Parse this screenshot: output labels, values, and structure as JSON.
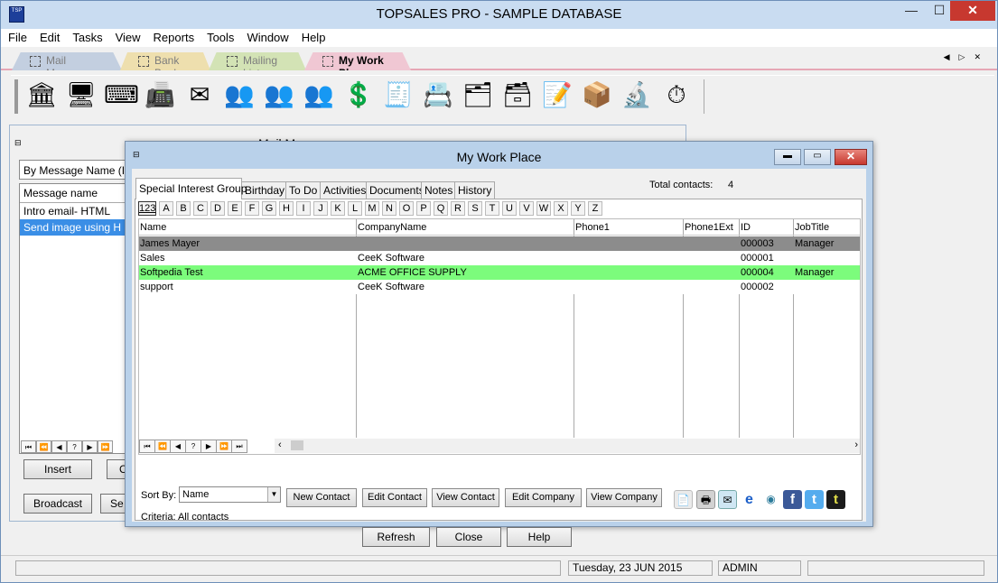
{
  "window": {
    "title": "TOPSALES PRO - SAMPLE DATABASE",
    "min": "—",
    "max": "☐",
    "close": "✕"
  },
  "menu": [
    "File",
    "Edit",
    "Tasks",
    "View",
    "Reports",
    "Tools",
    "Window",
    "Help"
  ],
  "doc_tabs": [
    "Mail Messages",
    "Bank Book",
    "Mailing Lists",
    "My Work Place"
  ],
  "toolbar_icons": [
    "🏛",
    "🖥",
    "⌨",
    "📠",
    "✉",
    "👥",
    "👥",
    "👥",
    "💲",
    "🧾",
    "📇",
    "🗂",
    "🗃",
    "📝",
    "📦",
    "🔬",
    "⏱"
  ],
  "mail": {
    "title": "Mail Messages",
    "sort_label": "By Message Name (I",
    "list_header": "Message name",
    "rows": [
      "Intro email- HTML",
      "Send image using H"
    ],
    "insert": "Insert",
    "ch": "Ch",
    "broadcast": "Broadcast",
    "se": "Se"
  },
  "mwp": {
    "title": "My Work Place",
    "tabs": [
      "Special Interest Group",
      "Birthday",
      "To Do",
      "Activities",
      "Documents",
      "Notes",
      "History"
    ],
    "total_label": "Total contacts:",
    "total_count": "4",
    "letters": [
      "123",
      "A",
      "B",
      "C",
      "D",
      "E",
      "F",
      "G",
      "H",
      "I",
      "J",
      "K",
      "L",
      "M",
      "N",
      "O",
      "P",
      "Q",
      "R",
      "S",
      "T",
      "U",
      "V",
      "W",
      "X",
      "Y",
      "Z"
    ],
    "columns": [
      "Name",
      "CompanyName",
      "Phone1",
      "Phone1Ext",
      "ID",
      "JobTitle"
    ],
    "rows": [
      {
        "name": "James Mayer",
        "company": "",
        "phone": "",
        "ext": "",
        "id": "000003",
        "job": "Manager",
        "color": "#8c8c8c"
      },
      {
        "name": "Sales",
        "company": "CeeK Software",
        "phone": "",
        "ext": "",
        "id": "000001",
        "job": "",
        "color": "#ffffff"
      },
      {
        "name": "Softpedia Test",
        "company": "ACME OFFICE SUPPLY",
        "phone": "",
        "ext": "",
        "id": "000004",
        "job": "Manager",
        "color": "#7cfc7c"
      },
      {
        "name": "support",
        "company": "CeeK Software",
        "phone": "",
        "ext": "",
        "id": "000002",
        "job": "",
        "color": "#ffffff"
      }
    ],
    "sort_by_label": "Sort By:",
    "sort_by_value": "Name",
    "actions": [
      "New Contact",
      "Edit Contact",
      "View Contact",
      "Edit Company",
      "View Company"
    ],
    "criteria": "Criteria: All contacts",
    "footer_buttons": [
      "Refresh",
      "Close",
      "Help"
    ],
    "social_icons": [
      "📄",
      "🖶",
      "✉",
      "e",
      "◉",
      "f",
      "t",
      "t"
    ]
  },
  "status": {
    "date": "Tuesday, 23 JUN 2015",
    "user": "ADMIN"
  }
}
